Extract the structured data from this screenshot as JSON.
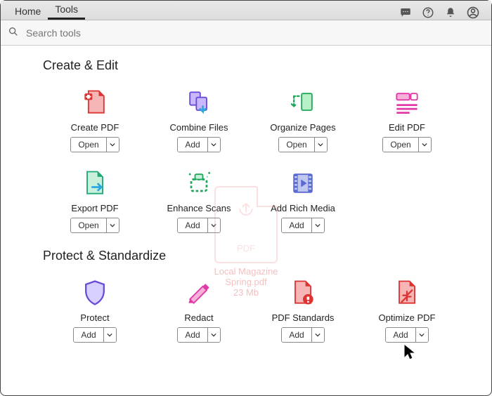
{
  "tabs": {
    "home": "Home",
    "tools": "Tools"
  },
  "search": {
    "placeholder": "Search tools"
  },
  "sections": {
    "create_edit": {
      "title": "Create & Edit",
      "tools": [
        {
          "id": "create-pdf",
          "label": "Create PDF",
          "action": "Open"
        },
        {
          "id": "combine",
          "label": "Combine Files",
          "action": "Add"
        },
        {
          "id": "organize",
          "label": "Organize Pages",
          "action": "Open"
        },
        {
          "id": "edit-pdf",
          "label": "Edit PDF",
          "action": "Open"
        },
        {
          "id": "export-pdf",
          "label": "Export PDF",
          "action": "Open"
        },
        {
          "id": "enhance",
          "label": "Enhance Scans",
          "action": "Add"
        },
        {
          "id": "rich-media",
          "label": "Add Rich Media",
          "action": "Add"
        }
      ]
    },
    "protect": {
      "title": "Protect & Standardize",
      "tools": [
        {
          "id": "protect",
          "label": "Protect",
          "action": "Add"
        },
        {
          "id": "redact",
          "label": "Redact",
          "action": "Add"
        },
        {
          "id": "standards",
          "label": "PDF Standards",
          "action": "Add"
        },
        {
          "id": "optimize",
          "label": "Optimize PDF",
          "action": "Add"
        }
      ]
    }
  },
  "ghost_file": {
    "name_line1": "Local Magazine",
    "name_line2": "Spring.pdf",
    "size": "23 Mb",
    "badge": "PDF"
  }
}
